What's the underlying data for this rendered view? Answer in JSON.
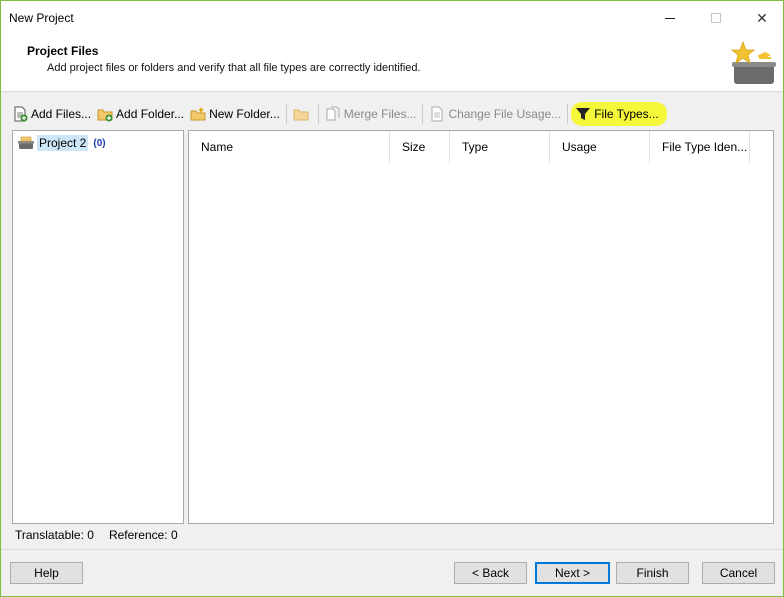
{
  "window": {
    "title": "New Project"
  },
  "header": {
    "title": "Project Files",
    "subtitle": "Add project files or folders and verify that all file types are correctly identified."
  },
  "toolbar": {
    "add_files": "Add Files...",
    "add_folder": "Add Folder...",
    "new_folder": "New Folder...",
    "merge_files": "Merge Files...",
    "change_file_usage": "Change File Usage...",
    "file_types": "File Types..."
  },
  "tree": {
    "project_label": "Project 2",
    "project_count": "(0)"
  },
  "grid": {
    "columns": [
      "Name",
      "Size",
      "Type",
      "Usage",
      "File Type Iden..."
    ]
  },
  "stats": {
    "translatable": "Translatable: 0",
    "reference": "Reference: 0"
  },
  "buttons": {
    "help": "Help",
    "back": "< Back",
    "next": "Next >",
    "finish": "Finish",
    "cancel": "Cancel"
  },
  "colors": {
    "highlight": "#f4f73a",
    "accent": "#0078d7",
    "selection": "#cde6f7"
  }
}
